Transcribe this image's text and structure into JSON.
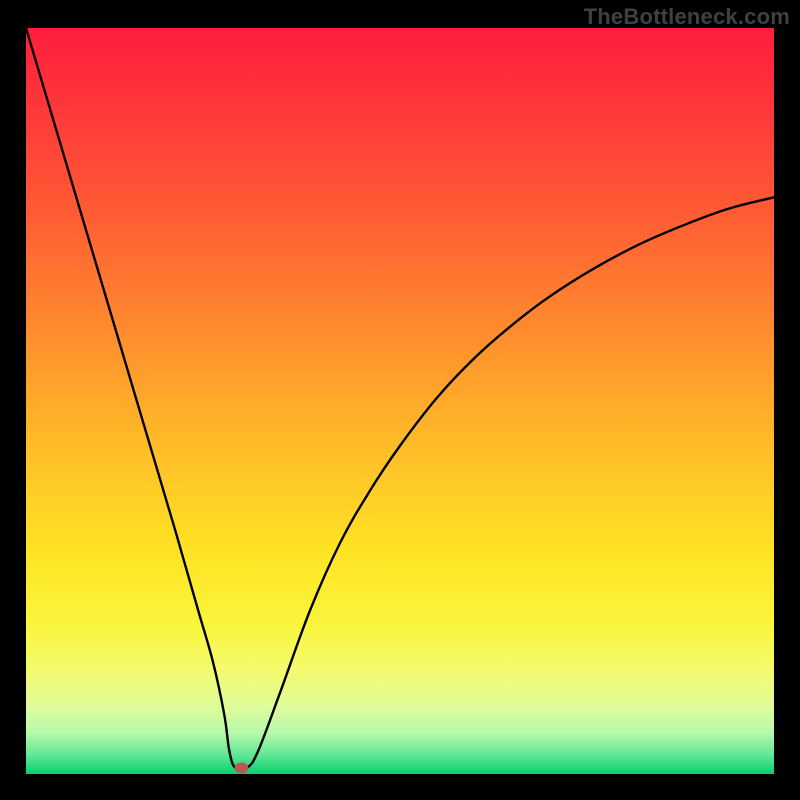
{
  "watermark": "TheBottleneck.com",
  "chart_data": {
    "type": "line",
    "title": "",
    "xlabel": "",
    "ylabel": "",
    "xlim": [
      0,
      100
    ],
    "ylim": [
      0,
      100
    ],
    "x": [
      0,
      4,
      8,
      12,
      16,
      20,
      23,
      25,
      26.5,
      27.2,
      28,
      29.5,
      31,
      34,
      38,
      42,
      46,
      50,
      55,
      60,
      65,
      70,
      76,
      82,
      88,
      94,
      100
    ],
    "values": [
      100,
      86.5,
      73,
      59.5,
      46,
      32.5,
      22,
      15,
      8,
      3,
      0.8,
      0.8,
      3,
      11,
      22,
      31,
      38,
      44,
      50.5,
      55.8,
      60.2,
      64,
      67.8,
      71,
      73.6,
      75.8,
      77.3
    ],
    "marker": {
      "x": 28.8,
      "y": 0.8,
      "color": "#b85a52"
    },
    "gradient_stops": [
      {
        "offset": 0.0,
        "color": "#ff1d3b"
      },
      {
        "offset": 0.12,
        "color": "#ff3a3a"
      },
      {
        "offset": 0.25,
        "color": "#ff5c34"
      },
      {
        "offset": 0.4,
        "color": "#ff8a2e"
      },
      {
        "offset": 0.55,
        "color": "#ffb928"
      },
      {
        "offset": 0.7,
        "color": "#ffe324"
      },
      {
        "offset": 0.8,
        "color": "#faf53b"
      },
      {
        "offset": 0.86,
        "color": "#f3fb6e"
      },
      {
        "offset": 0.91,
        "color": "#dffc9a"
      },
      {
        "offset": 0.945,
        "color": "#b7f9ac"
      },
      {
        "offset": 0.975,
        "color": "#5ee795"
      },
      {
        "offset": 1.0,
        "color": "#09cf72"
      }
    ]
  }
}
